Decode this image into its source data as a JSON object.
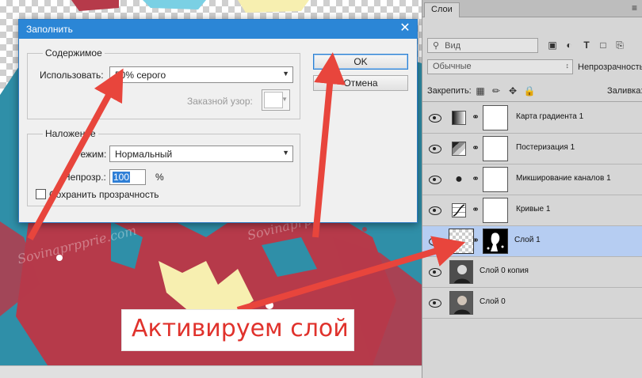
{
  "dialog": {
    "title": "Заполнить",
    "close": "✕",
    "contents": {
      "legend": "Содержимое",
      "use_label": "Использовать:",
      "use_value": "50% серого",
      "custom_pattern_label": "Заказной узор:"
    },
    "blending": {
      "legend": "Наложение",
      "mode_label": "Режим:",
      "mode_value": "Нормальный",
      "opacity_label": "Непрозр.:",
      "opacity_value": "100",
      "opacity_unit": "%",
      "preserve_transparency_label": "Сохранить прозрачность",
      "preserve_transparency_checked": false
    },
    "ok_label": "OK",
    "cancel_label": "Отмена"
  },
  "layers_panel": {
    "tab_label": "Слои",
    "filter_placeholder": "Вид",
    "blend_mode": "Обычные",
    "opacity_label": "Непрозрачность:",
    "lock_label": "Закрепить:",
    "fill_label": "Заливка:",
    "layers": [
      {
        "name": "Карта градиента 1",
        "kind": "adjustment",
        "icon": "gradient-map-icon",
        "selected": false
      },
      {
        "name": "Постеризация 1",
        "kind": "adjustment",
        "icon": "posterize-icon",
        "selected": false
      },
      {
        "name": "Микширование каналов 1",
        "kind": "adjustment",
        "icon": "channel-mixer-icon",
        "selected": false
      },
      {
        "name": "Кривые 1",
        "kind": "adjustment",
        "icon": "curves-icon",
        "selected": false
      },
      {
        "name": "Слой 1",
        "kind": "pixel-with-mask",
        "icon": "transparent-thumb",
        "selected": true
      },
      {
        "name": "Слой 0 копия",
        "kind": "photo",
        "icon": "photo-thumb",
        "selected": false
      },
      {
        "name": "Слой 0",
        "kind": "photo",
        "icon": "photo-thumb",
        "selected": false
      }
    ]
  },
  "annotation": {
    "callout_text": "Активируем слой",
    "arrow_color": "#e8453c"
  },
  "colors": {
    "canvas_blue": "#2f8fa8",
    "canvas_red": "#b63a4a",
    "canvas_yellow": "#f7efb0",
    "dialog_titlebar": "#2b86d6",
    "selected_layer": "#b6cdf2"
  }
}
